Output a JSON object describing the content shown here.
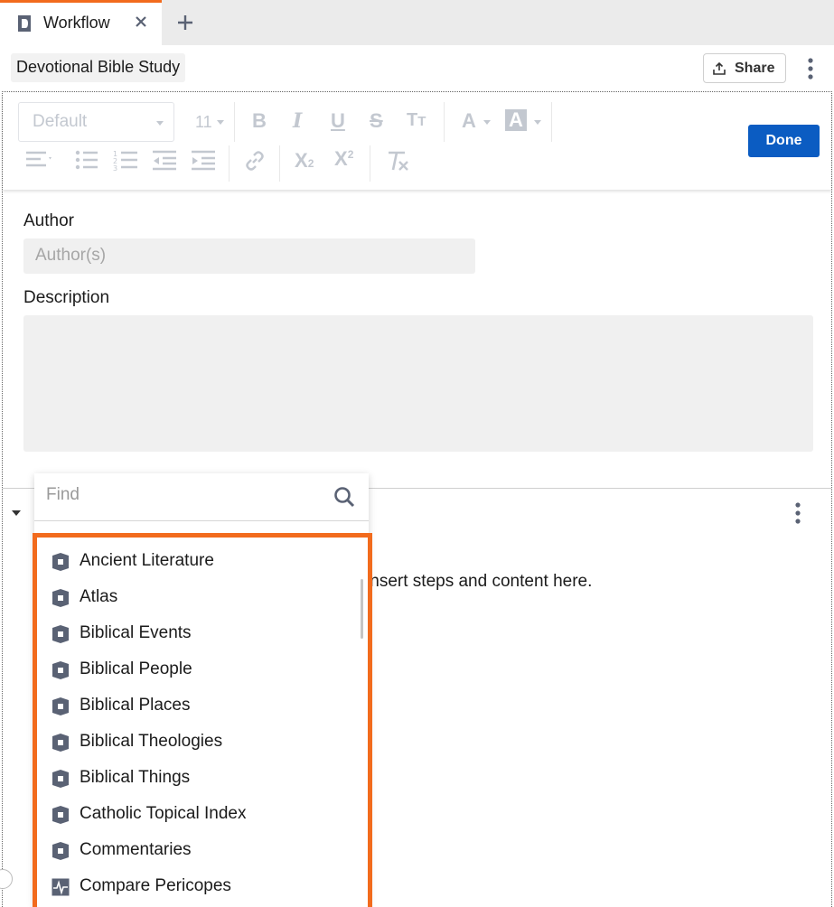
{
  "tab": {
    "label": "Workflow"
  },
  "header": {
    "title": "Devotional Bible Study",
    "share_label": "Share"
  },
  "toolbar": {
    "font_family": "Default",
    "font_size": "11",
    "done_label": "Done",
    "icons": [
      "bold-icon",
      "italic-icon",
      "underline-icon",
      "strikethrough-icon",
      "text-size-icon",
      "font-color-icon",
      "highlight-color-icon",
      "align-icon",
      "bullet-list-icon",
      "numbered-list-icon",
      "outdent-icon",
      "indent-icon",
      "link-icon",
      "subscript-icon",
      "superscript-icon",
      "clear-format-icon"
    ]
  },
  "form": {
    "author_label": "Author",
    "author_placeholder": "Author(s)",
    "description_label": "Description"
  },
  "section": {
    "hint": "Insert steps and content here."
  },
  "finder": {
    "placeholder": "Find",
    "items": [
      {
        "label": "Ancient Literature",
        "icon": "guide-icon"
      },
      {
        "label": "Atlas",
        "icon": "guide-icon"
      },
      {
        "label": "Biblical Events",
        "icon": "guide-icon"
      },
      {
        "label": "Biblical People",
        "icon": "guide-icon"
      },
      {
        "label": "Biblical Places",
        "icon": "guide-icon"
      },
      {
        "label": "Biblical Theologies",
        "icon": "guide-icon"
      },
      {
        "label": "Biblical Things",
        "icon": "guide-icon"
      },
      {
        "label": "Catholic Topical Index",
        "icon": "guide-icon"
      },
      {
        "label": "Commentaries",
        "icon": "guide-icon"
      },
      {
        "label": "Compare Pericopes",
        "icon": "compare-icon"
      }
    ]
  },
  "colors": {
    "accent": "#f26b1d",
    "primary": "#0b5cc2",
    "icon": "#5a6274"
  }
}
